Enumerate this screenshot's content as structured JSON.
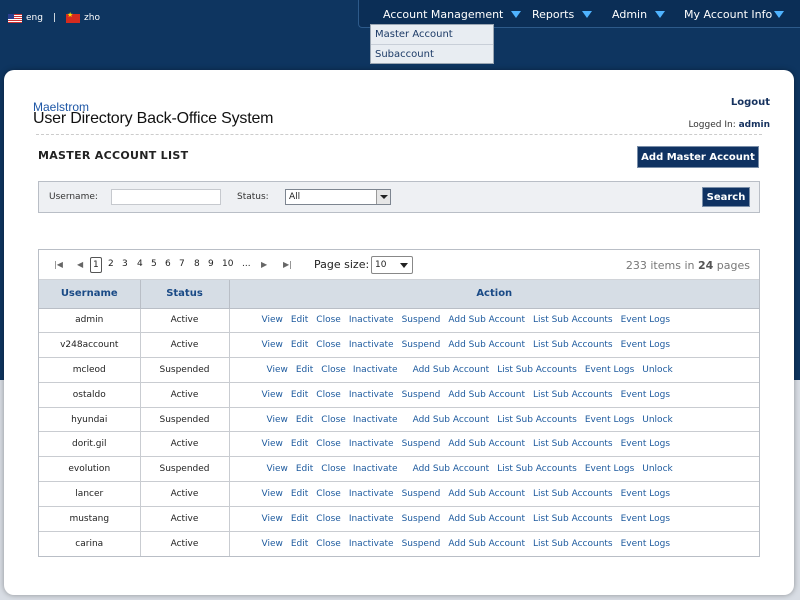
{
  "lang": {
    "items": [
      {
        "label": "eng",
        "icon": "us-flag-icon"
      },
      {
        "label": "zho",
        "icon": "cn-flag-icon"
      }
    ],
    "separator": "|"
  },
  "nav": {
    "items": [
      "Account Management",
      "Reports",
      "Admin",
      "My Account Info"
    ],
    "dropdown": [
      "Master Account",
      "Subaccount"
    ],
    "colors": {
      "bar": "#0b2e56",
      "arrow": "#4fb3ff"
    }
  },
  "header": {
    "brand": "Maelstrom",
    "title": "User Directory Back-Office System",
    "logout": "Logout",
    "logged_in_label": "Logged In:",
    "user": "admin"
  },
  "page": {
    "title": "MASTER ACCOUNT LIST",
    "add_button": "Add Master Account"
  },
  "search": {
    "username_label": "Username:",
    "username_value": "",
    "status_label": "Status:",
    "status_value": "All",
    "button": "Search"
  },
  "pager": {
    "pages": [
      "1",
      "2",
      "3",
      "4",
      "5",
      "6",
      "7",
      "8",
      "9",
      "10",
      "..."
    ],
    "current_page": "1",
    "page_size_label": "Page size:",
    "page_size": "10",
    "total_items": "233",
    "items_label": "items in",
    "total_pages": "24",
    "pages_label": "pages"
  },
  "table": {
    "columns": [
      "Username",
      "Status",
      "Action"
    ],
    "active_actions": [
      "View",
      "Edit",
      "Close",
      "Inactivate",
      "Suspend",
      "Add Sub Account",
      "List Sub Accounts",
      "Event Logs"
    ],
    "suspended_actions": [
      "View",
      "Edit",
      "Close",
      "Inactivate",
      "Add Sub Account",
      "List Sub Accounts",
      "Event Logs",
      "Unlock"
    ],
    "rows": [
      {
        "username": "admin",
        "status": "Active"
      },
      {
        "username": "v248account",
        "status": "Active"
      },
      {
        "username": "mcleod",
        "status": "Suspended"
      },
      {
        "username": "ostaldo",
        "status": "Active"
      },
      {
        "username": "hyundai",
        "status": "Suspended"
      },
      {
        "username": "dorit.gil",
        "status": "Active"
      },
      {
        "username": "evolution",
        "status": "Suspended"
      },
      {
        "username": "lancer",
        "status": "Active"
      },
      {
        "username": "mustang",
        "status": "Active"
      },
      {
        "username": "carina",
        "status": "Active"
      }
    ]
  },
  "colors": {
    "primary": "#0f3262",
    "link": "#1d5a9e",
    "header_bg": "#d6dde5"
  }
}
